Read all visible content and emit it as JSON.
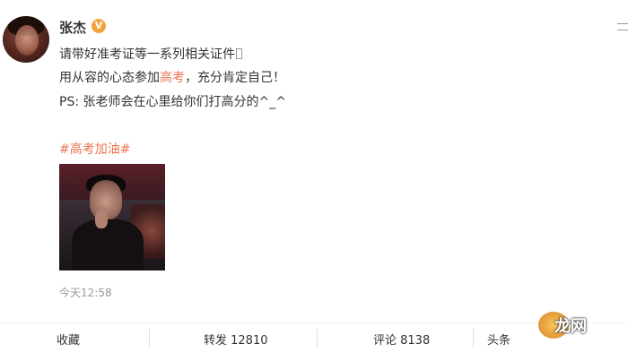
{
  "post": {
    "author": "张杰",
    "verified_badge": "V",
    "lines": {
      "line1": "请带好准考证等一系列相关证件",
      "line2_prefix": "用从容的心态参加",
      "line2_link": "高考",
      "line2_suffix": "，充分肯定自己！",
      "line3": "PS: 张老师会在心里给你们打高分的^_^"
    },
    "hashtag": "#高考加油#",
    "timestamp": "今天12:58"
  },
  "actions": {
    "favorite": "收藏",
    "repost": "转发 12810",
    "comment": "评论 8138",
    "like_partial": "头条"
  },
  "watermark": {
    "text": "龙网"
  },
  "colors": {
    "link": "#eb7350",
    "text": "#333333",
    "muted": "#999999",
    "badge": "#f2a43a"
  }
}
